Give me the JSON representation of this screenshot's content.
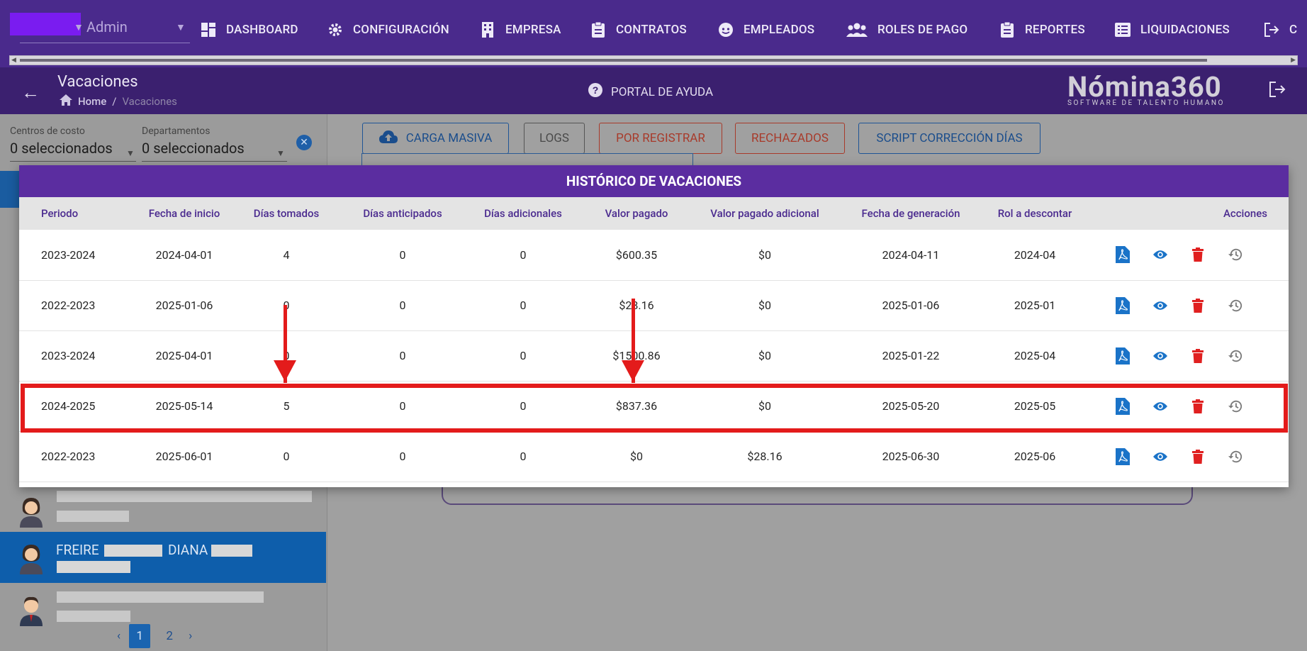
{
  "nav": {
    "user": "Admin",
    "items": [
      {
        "label": "DASHBOARD",
        "icon": "dashboard-icon"
      },
      {
        "label": "CONFIGURACIÓN",
        "icon": "gear-icon"
      },
      {
        "label": "EMPRESA",
        "icon": "building-icon"
      },
      {
        "label": "CONTRATOS",
        "icon": "clipboard-icon"
      },
      {
        "label": "EMPLEADOS",
        "icon": "face-icon"
      },
      {
        "label": "ROLES DE PAGO",
        "icon": "group-icon"
      },
      {
        "label": "REPORTES",
        "icon": "clipboard-icon"
      },
      {
        "label": "LIQUIDACIONES",
        "icon": "list-icon"
      }
    ],
    "logout_partial": "C"
  },
  "header": {
    "title": "Vacaciones",
    "breadcrumb_home": "Home",
    "breadcrumb_current": "Vacaciones",
    "help_label": "PORTAL DE AYUDA",
    "logo_text": "Nómina360",
    "logo_tagline": "SOFTWARE DE TALENTO HUMANO"
  },
  "filters": {
    "centros_label": "Centros de costo",
    "centros_value": "0 seleccionados",
    "departamentos_label": "Departamentos",
    "departamentos_value": "0 seleccionados"
  },
  "employees": {
    "selected_first": "FREIRE",
    "selected_second": "DIANA"
  },
  "pagination": {
    "pages": [
      "1",
      "2"
    ],
    "active": "1"
  },
  "toolbar": {
    "carga_masiva": "CARGA MASIVA",
    "logs": "LOGS",
    "por_registrar": "POR REGISTRAR",
    "rechazados": "RECHAZADOS",
    "script": "SCRIPT CORRECCIÓN DÍAS"
  },
  "modal": {
    "title": "HISTÓRICO DE VACACIONES",
    "columns": [
      "Periodo",
      "Fecha de inicio",
      "Días tomados",
      "Días anticipados",
      "Días adicionales",
      "Valor pagado",
      "Valor pagado adicional",
      "Fecha de generación",
      "Rol a descontar",
      "Acciones"
    ],
    "rows": [
      [
        "2023-2024",
        "2024-04-01",
        "4",
        "0",
        "0",
        "$600.35",
        "$0",
        "2024-04-11",
        "2024-04"
      ],
      [
        "2022-2023",
        "2025-01-06",
        "0",
        "0",
        "0",
        "$28.16",
        "$0",
        "2025-01-06",
        "2025-01"
      ],
      [
        "2023-2024",
        "2025-04-01",
        "0",
        "0",
        "0",
        "$1500.86",
        "$0",
        "2025-01-22",
        "2025-04"
      ],
      [
        "2024-2025",
        "2025-05-14",
        "5",
        "0",
        "0",
        "$837.36",
        "$0",
        "2025-05-20",
        "2025-05"
      ],
      [
        "2022-2023",
        "2025-06-01",
        "0",
        "0",
        "0",
        "$0",
        "$28.16",
        "2025-06-30",
        "2025-06"
      ]
    ],
    "highlighted_row": 3
  },
  "colors": {
    "nav_bg": "#4a2a8c",
    "modal_header": "#5b2da0",
    "pdf_icon": "#1a73c8",
    "eye_icon": "#1a73c8",
    "delete_icon": "#e02020",
    "history_icon": "#7a7a7a",
    "annotation": "#e31b1b"
  }
}
